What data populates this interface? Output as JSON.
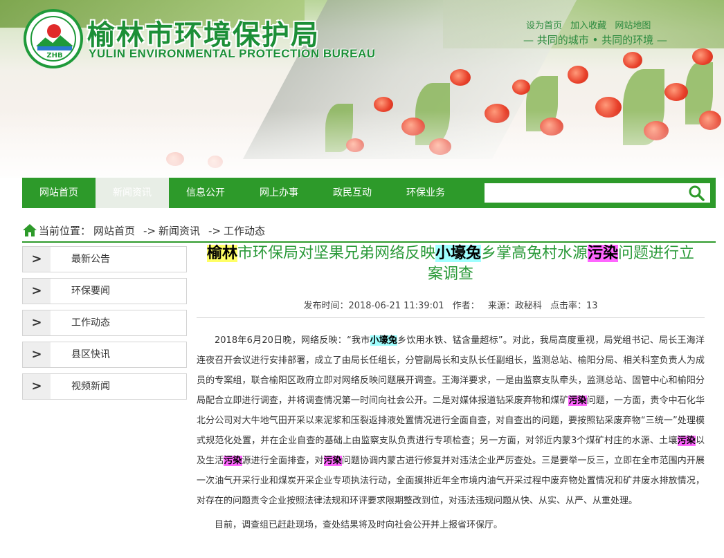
{
  "header": {
    "title_cn": "榆林市环境保护局",
    "title_en": "YULIN ENVIRONMENTAL PROTECTION BUREAU",
    "logo_text": "ZHB",
    "top_links": [
      "设为首页",
      "加入收藏",
      "网站地图"
    ],
    "slogan": "— 共同的城市 • 共同的环境 —"
  },
  "nav": {
    "items": [
      "网站首页",
      "新闻资讯",
      "信息公开",
      "网上办事",
      "政民互动",
      "环保业务"
    ],
    "active_index": 1,
    "search_placeholder": ""
  },
  "breadcrumb": {
    "label": "当前位置：",
    "items": [
      "网站首页",
      "新闻资讯",
      "工作动态"
    ],
    "separator": "->"
  },
  "sidebar": {
    "items": [
      "最新公告",
      "环保要闻",
      "工作动态",
      "县区快讯",
      "视频新闻"
    ],
    "arrow": ">"
  },
  "article": {
    "title_parts": [
      "榆林",
      "市环保局对坚果兄弟网络反映",
      "小壕兔",
      "乡掌高兔村水源",
      "污染",
      "问题进行立案调查"
    ],
    "meta": {
      "publish_time": "发布时间：2018-06-21 11:39:01",
      "author": "作者：",
      "source": "来源：政秘科",
      "clicks": "点击率：13"
    },
    "para1": [
      "2018年6月20日晚，网络反映：“我市",
      "小壕兔",
      "乡饮用水铁、锰含量超标”。对此，我局高度重视，局党组书记、局长王海洋连夜召开会议进行安排部署，成立了由局长任组长，分管副局长和支队长任副组长，监测总站、榆阳分局、相关科室负责人为成员的专案组，联合榆阳区政府立即对网络反映问题展开调查。王海洋要求，一是由监察支队牵头，监测总站、固管中心和榆阳分局配合立即进行调查，并将调查情况第一时间向社会公开。二是对媒体报道钻采废弃物和煤矿",
      "污染",
      "问题，一方面，责令中石化华北分公司对大牛地气田开采以来泥浆和压裂返排液处置情况进行全面自查，对自查出的问题，要按照钻采废弃物“三统一”处理模式规范化处置，并在企业自查的基础上由监察支队负责进行专项检查；另一方面，对邻近内蒙3个煤矿村庄的水源、土壤",
      "污染",
      "以及生活",
      "污染",
      "源进行全面排查，对",
      "污染",
      "问题协调内蒙古进行修复并对违法企业严厉查处。三是要举一反三，立即在全市范围内开展一次油气开采行业和煤炭开采企业专项执法行动，全面摸排近年全市境内油气开采过程中废弃物处置情况和矿井废水排放情况，对存在的问题责令企业按照法律法规和环评要求限期整改到位，对违法违规问题从快、从实、从严、从重处理。"
    ],
    "para2": "目前，调查组已赶赴现场，查处结果将及时向社会公开并上报省环保厅。"
  },
  "colors": {
    "brand_green": "#2d9a2a",
    "title_green": "#2b9a3a",
    "highlight_yellow": "#ffff66",
    "highlight_cyan": "#a0ffff",
    "highlight_magenta": "#ff66ff"
  }
}
